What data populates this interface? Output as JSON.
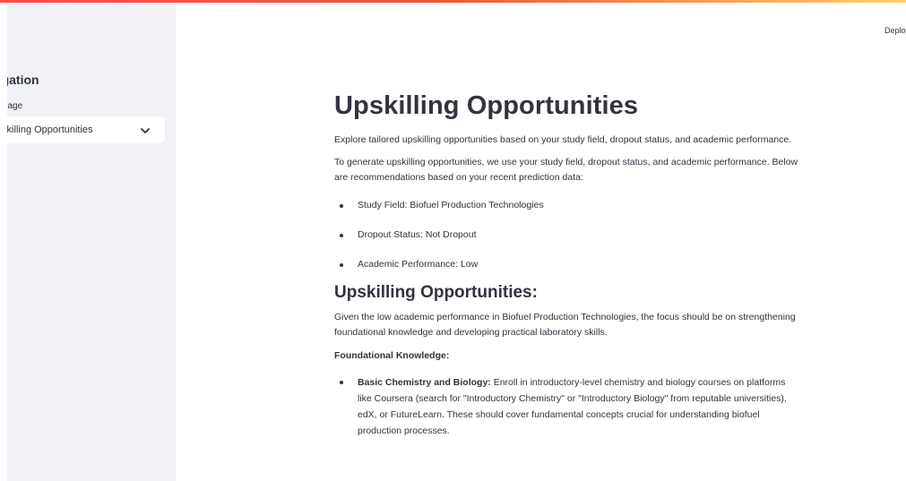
{
  "sidebar": {
    "title": "Navigation",
    "select_label": "Select a page",
    "selected_page": "Upskilling Opportunities"
  },
  "header": {
    "deploy_label": "Deploy"
  },
  "main": {
    "title": "Upskilling Opportunities",
    "intro": "Explore tailored upskilling opportunities based on your study field, dropout status, and academic performance.",
    "explanation": "To generate upskilling opportunities, we use your study field, dropout status, and academic performance. Below are recommendations based on your recent prediction data:",
    "prediction_items": [
      "Study Field: Biofuel Production Technologies",
      "Dropout Status: Not Dropout",
      "Academic Performance: Low"
    ],
    "subheading": "Upskilling Opportunities:",
    "summary": "Given the low academic performance in Biofuel Production Technologies, the focus should be on strengthening foundational knowledge and developing practical laboratory skills.",
    "section_label": "Foundational Knowledge:",
    "recommendations": [
      {
        "title": "Basic Chemistry and Biology:",
        "text": " Enroll in introductory-level chemistry and biology courses on platforms like Coursera (search for \"Introductory Chemistry\" or \"Introductory Biology\" from reputable universities), edX, or FutureLearn. These should cover fundamental concepts crucial for understanding biofuel production processes."
      }
    ]
  },
  "colors": {
    "sidebar_bg": "#f0f2f6",
    "text": "#31333f",
    "accent_bar_start": "#ff4b4b",
    "accent_bar_end": "#ffd16a"
  }
}
